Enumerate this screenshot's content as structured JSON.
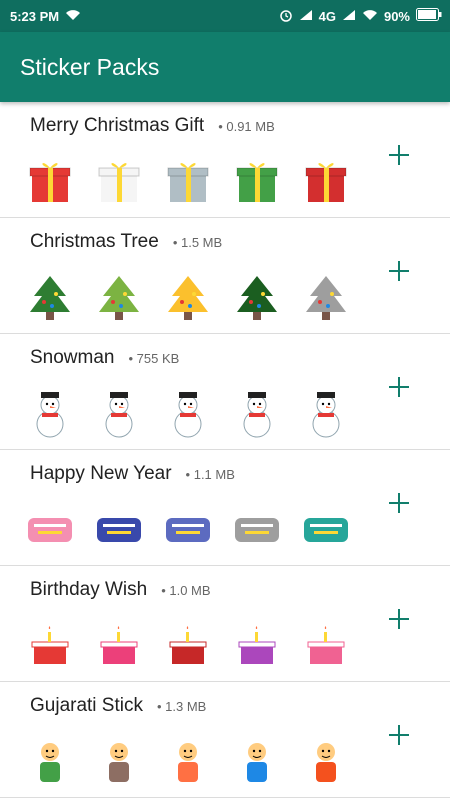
{
  "status": {
    "time": "5:23 PM",
    "network": "4G",
    "battery": "90%"
  },
  "app": {
    "title": "Sticker Packs"
  },
  "packs": [
    {
      "name": "Merry Christmas Gift",
      "size": "0.91 MB",
      "stickers": [
        "gift-red",
        "gift-white",
        "gift-silver",
        "gift-green",
        "gift-red-stack"
      ]
    },
    {
      "name": "Christmas Tree",
      "size": "1.5 MB",
      "stickers": [
        "tree-decorated",
        "tree-snowy",
        "tree-gold",
        "tree-green",
        "tree-silver"
      ]
    },
    {
      "name": "Snowman",
      "size": "755 KB",
      "stickers": [
        "snowman-1",
        "snowman-2",
        "snowman-3",
        "snowman-4",
        "snowman-5"
      ]
    },
    {
      "name": "Happy New Year",
      "size": "1.1 MB",
      "stickers": [
        "newyear-text",
        "newyear-badge",
        "newyear-banner",
        "newyear-calligraphy",
        "newyear-fireworks"
      ]
    },
    {
      "name": "Birthday Wish",
      "size": "1.0 MB",
      "stickers": [
        "birthday-cake",
        "birthday-floral",
        "birthday-text",
        "birthday-pink",
        "birthday-gift"
      ]
    },
    {
      "name": "Gujarati Stick",
      "size": "1.3 MB",
      "stickers": [
        "gujarati-text",
        "gujarati-girl",
        "gujarati-cartoon-1",
        "gujarati-cartoon-2",
        "gujarati-cartoon-3"
      ]
    }
  ]
}
